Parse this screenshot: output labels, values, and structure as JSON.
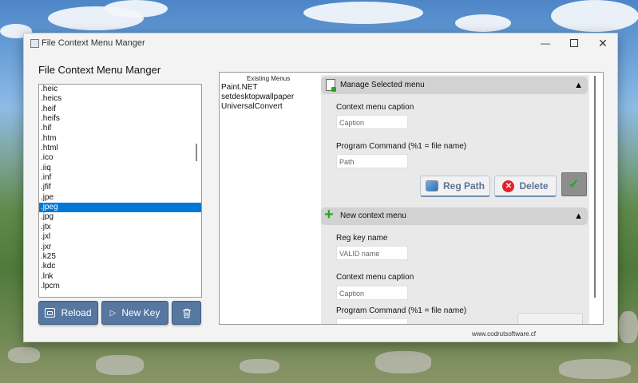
{
  "window": {
    "title": "File Context Menu Manger"
  },
  "heading": "File Context Menu Manger",
  "extensions": [
    ".heic",
    ".heics",
    ".heif",
    ".heifs",
    ".hif",
    ".htm",
    ".html",
    ".ico",
    ".iiq",
    ".inf",
    ".jfif",
    ".jpe",
    ".jpeg",
    ".jpg",
    ".jtx",
    ".jxl",
    ".jxr",
    ".k25",
    ".kdc",
    ".lnk",
    ".lpcm"
  ],
  "selected_extension_index": 12,
  "buttons": {
    "reload": "Reload",
    "new_key": "New Key"
  },
  "existing_menus": {
    "label": "Existing Menus",
    "items": [
      "Paint.NET",
      "setdesktopwallpaper",
      "UniversalConvert"
    ]
  },
  "manage": {
    "title": "Manage Selected menu",
    "caption_label": "Context menu caption",
    "caption_placeholder": "Caption",
    "command_label": "Program Command (%1 = file name)",
    "command_placeholder": "Path",
    "reg_path": "Reg Path",
    "delete": "Delete"
  },
  "new_menu": {
    "title": "New context menu",
    "reg_key_label": "Reg key name",
    "reg_key_placeholder": "VALID name",
    "caption_label": "Context menu caption",
    "caption_placeholder": "Caption",
    "command_label": "Program Command (%1 = file name)"
  },
  "footer": "www.codrutsoftware.cf",
  "colors": {
    "accent_button": "#5577a0",
    "selection": "#0078d7",
    "delete_red": "#e0202a",
    "confirm_green": "#22aa22"
  }
}
